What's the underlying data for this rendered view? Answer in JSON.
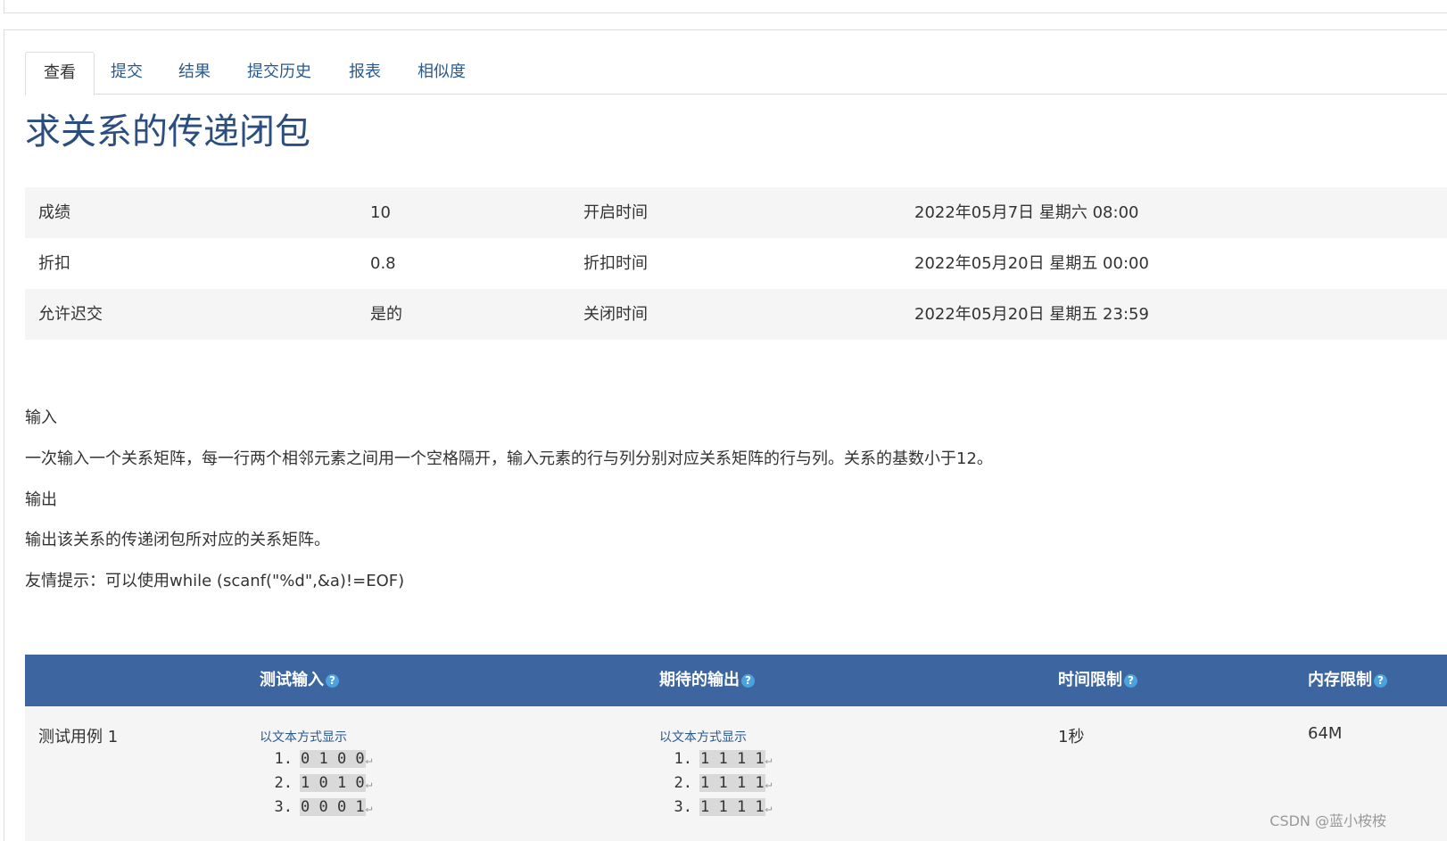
{
  "tabs": [
    {
      "label": "查看",
      "active": true
    },
    {
      "label": "提交"
    },
    {
      "label": "结果"
    },
    {
      "label": "提交历史"
    },
    {
      "label": "报表"
    },
    {
      "label": "相似度"
    }
  ],
  "page_title": "求关系的传递闭包",
  "info": [
    {
      "k1": "成绩",
      "v1": "10",
      "k2": "开启时间",
      "v2": "2022年05月7日 星期六 08:00"
    },
    {
      "k1": "折扣",
      "v1": "0.8",
      "k2": "折扣时间",
      "v2": "2022年05月20日 星期五 00:00"
    },
    {
      "k1": "允许迟交",
      "v1": "是的",
      "k2": "关闭时间",
      "v2": "2022年05月20日 星期五 23:59"
    }
  ],
  "description": {
    "input_heading": "输入",
    "input_text": "一次输入一个关系矩阵，每一行两个相邻元素之间用一个空格隔开，输入元素的行与列分别对应关系矩阵的行与列。关系的基数小于12。",
    "output_heading": "输出",
    "output_text": "输出该关系的传递闭包所对应的关系矩阵。",
    "hint": "友情提示：可以使用while (scanf(\"%d\",&a)!=EOF)"
  },
  "testcase_table": {
    "headers": {
      "input": "测试输入",
      "expected": "期待的输出",
      "time": "时间限制",
      "memory": "内存限制"
    },
    "help_glyph": "?",
    "row": {
      "name": "测试用例 1",
      "show_as_text": "以文本方式显示",
      "input_lines": [
        {
          "num": "1.",
          "text": "0 1 0 0"
        },
        {
          "num": "2.",
          "text": "1 0 1 0"
        },
        {
          "num": "3.",
          "text": "0 0 0 1"
        }
      ],
      "output_lines": [
        {
          "num": "1.",
          "text": "1 1 1 1"
        },
        {
          "num": "2.",
          "text": "1 1 1 1"
        },
        {
          "num": "3.",
          "text": "1 1 1 1"
        }
      ],
      "time_limit": "1秒",
      "memory_limit": "64M"
    },
    "return_glyph": "↵"
  },
  "watermark": "CSDN @蓝小桉桉",
  "colors": {
    "header_bg": "#3d65a0",
    "title": "#2b4e7f",
    "link": "#2a5a8e",
    "help_icon": "#4aa3df"
  }
}
